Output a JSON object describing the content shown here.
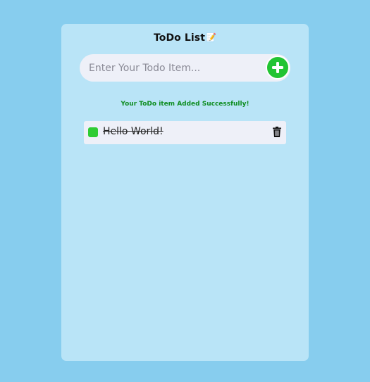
{
  "app": {
    "title": "ToDo List",
    "title_icon": "📝"
  },
  "input": {
    "placeholder": "Enter Your Todo Item...",
    "value": ""
  },
  "add_button": {
    "icon": "plus-icon",
    "color": "#22c433"
  },
  "status": {
    "message": "Your ToDo item Added Successfully!",
    "color": "#0f8d22"
  },
  "todos": [
    {
      "text": "Hello World!",
      "completed": true,
      "checkbox_color": "#2fcc33",
      "delete_icon": "trash-icon"
    }
  ]
}
